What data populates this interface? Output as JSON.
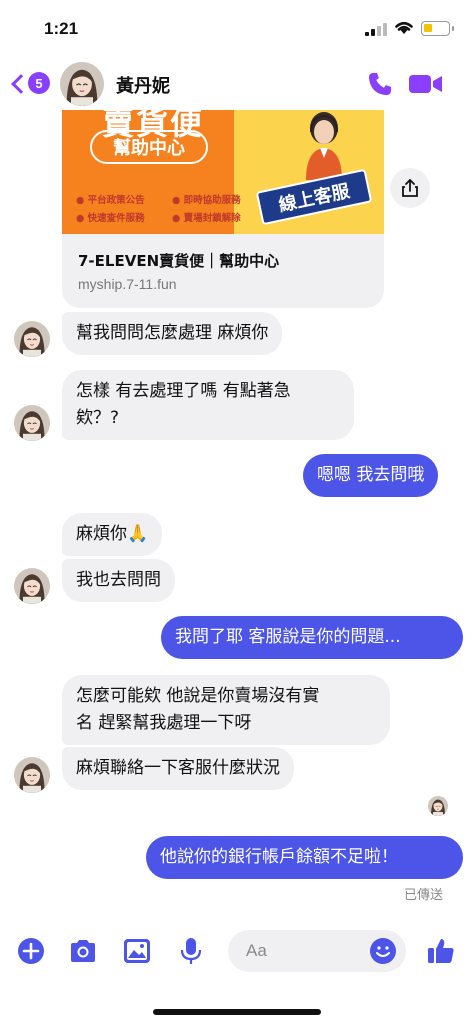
{
  "status_bar": {
    "time": "1:21"
  },
  "header": {
    "contact_name": "黃丹妮",
    "unread_count": "5"
  },
  "link_preview": {
    "banner_top_text": "賣貨便",
    "banner_pill": "幫助中心",
    "features": [
      "平台政策公告",
      "即時協助服務",
      "快速查件服務",
      "賣場封鎖解除"
    ],
    "service_tag": "線上客服",
    "title": "7-ELEVEN賣貨便｜幫助中心",
    "url": "myship.7-11.fun"
  },
  "messages": [
    {
      "dir": "in",
      "text": "幫我問問怎麼處理 麻煩你"
    },
    {
      "dir": "in",
      "text_line1": "怎樣 有去處理了嗎 有點著急",
      "text_line2": "欸？?"
    },
    {
      "dir": "out",
      "text": "嗯嗯 我去問哦"
    },
    {
      "dir": "in",
      "text": "麻煩你🙏"
    },
    {
      "dir": "in",
      "text": "我也去問問"
    },
    {
      "dir": "out",
      "text": "我問了耶 客服說是你的問題..."
    },
    {
      "dir": "in",
      "text_line1": "怎麼可能欸 他說是你賣場沒有實",
      "text_line2": "名 趕緊幫我處理一下呀"
    },
    {
      "dir": "in",
      "text": "麻煩聯絡一下客服什麼狀況"
    },
    {
      "dir": "out",
      "text": "他說你的銀行帳戶餘額不足啦！"
    }
  ],
  "sent_status": "已傳送",
  "composer": {
    "placeholder": "Aa"
  },
  "colors": {
    "accent": "#8a3ffc",
    "outgoing_bubble": "#4c55e8",
    "incoming_bubble": "#f0f0f2"
  }
}
